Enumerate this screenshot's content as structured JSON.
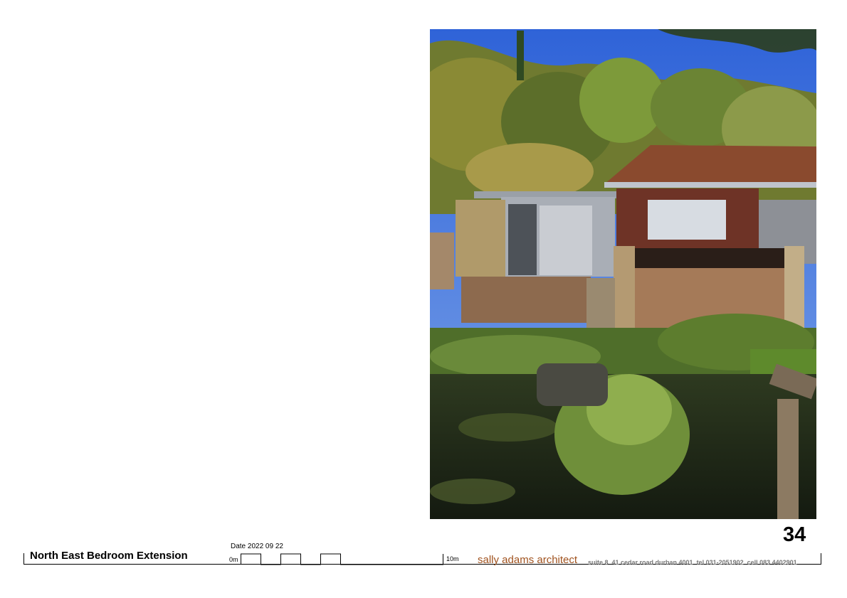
{
  "page": {
    "number": "34"
  },
  "title_block": {
    "drawing_title": "North East Bedroom Extension",
    "date": "Date 2022 09 22",
    "scale_start": "0m",
    "scale_end": "10m",
    "architect": "sally adams architect",
    "contact": "suite 8  41 cedar road durban 4001  tel 031-2051902  cell 083 4402901"
  },
  "photo": {
    "icon": "house-garden-photo"
  },
  "colors": {
    "architect_brand": "#a0521e",
    "contact_text": "#777777"
  }
}
